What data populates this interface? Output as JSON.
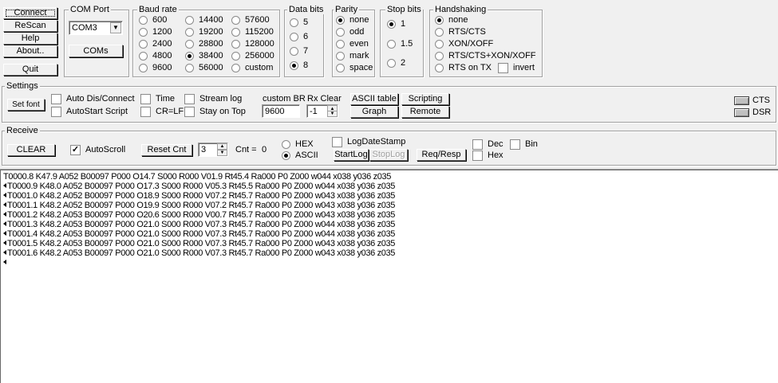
{
  "buttons": {
    "connect": "Connect",
    "rescan": "ReScan",
    "help": "Help",
    "about": "About..",
    "quit": "Quit"
  },
  "com_port": {
    "title": "COM Port",
    "selected": "COM3",
    "coms_button": "COMs"
  },
  "baud_rate": {
    "title": "Baud rate",
    "options": [
      "600",
      "1200",
      "2400",
      "4800",
      "9600",
      "14400",
      "19200",
      "28800",
      "38400",
      "56000",
      "57600",
      "115200",
      "128000",
      "256000",
      "custom"
    ],
    "selected": "38400"
  },
  "data_bits": {
    "title": "Data bits",
    "options": [
      "5",
      "6",
      "7",
      "8"
    ],
    "selected": "8"
  },
  "parity": {
    "title": "Parity",
    "options": [
      "none",
      "odd",
      "even",
      "mark",
      "space"
    ],
    "selected": "none"
  },
  "stop_bits": {
    "title": "Stop bits",
    "options": [
      "1",
      "1.5",
      "2"
    ],
    "selected": "1"
  },
  "handshaking": {
    "title": "Handshaking",
    "options": [
      "none",
      "RTS/CTS",
      "XON/XOFF",
      "RTS/CTS+XON/XOFF",
      "RTS on TX"
    ],
    "selected": "none",
    "invert_label": "invert",
    "invert_checked": false
  },
  "settings": {
    "title": "Settings",
    "set_font": "Set font",
    "auto_dis_connect": "Auto Dis/Connect",
    "autostart_script": "AutoStart Script",
    "time": "Time",
    "cr_lf": "CR=LF",
    "stream_log": "Stream log",
    "stay_on_top": "Stay on Top",
    "custom_br_label": "custom BR",
    "custom_br_value": "9600",
    "rx_clear_label": "Rx Clear",
    "rx_clear_value": "-1",
    "ascii_table": "ASCII table",
    "graph": "Graph",
    "scripting": "Scripting",
    "remote": "Remote"
  },
  "status": {
    "cts": "CTS",
    "dsr": "DSR"
  },
  "receive": {
    "title": "Receive",
    "clear": "CLEAR",
    "autoscroll": "AutoScroll",
    "autoscroll_checked": true,
    "reset_cnt": "Reset Cnt",
    "cnt_spin_value": "3",
    "cnt_label": "Cnt =",
    "cnt_value": "0",
    "hex": "HEX",
    "ascii": "ASCII",
    "mode_selected": "ASCII",
    "log_date_stamp": "LogDateStamp",
    "start_log": "StartLog",
    "stop_log": "StopLog",
    "req_resp": "Req/Resp",
    "dec": "Dec",
    "hex_cb": "Hex",
    "bin": "Bin"
  },
  "terminal": {
    "lines": [
      {
        "arrow": false,
        "text": "T0000.8 K47.9 A052 B00097 P000 O14.7 S000 R000 V01.9 Rt45.4 Ra000 P0 Z000 w044 x038 y036 z035"
      },
      {
        "arrow": true,
        "text": "T0000.9 K48.0 A052 B00097 P000 O17.3 S000 R000 V05.3 Rt45.5 Ra000 P0 Z000 w044 x038 y036 z035"
      },
      {
        "arrow": true,
        "text": "T0001.0 K48.2 A052 B00097 P000 O18.9 S000 R000 V07.2 Rt45.7 Ra000 P0 Z000 w043 x038 y036 z035"
      },
      {
        "arrow": true,
        "text": "T0001.1 K48.2 A052 B00097 P000 O19.9 S000 R000 V07.2 Rt45.7 Ra000 P0 Z000 w043 x038 y036 z035"
      },
      {
        "arrow": true,
        "text": "T0001.2 K48.2 A053 B00097 P000 O20.6 S000 R000 V00.7 Rt45.7 Ra000 P0 Z000 w043 x038 y036 z035"
      },
      {
        "arrow": true,
        "text": "T0001.3 K48.2 A053 B00097 P000 O21.0 S000 R000 V07.3 Rt45.7 Ra000 P0 Z000 w044 x038 y036 z035"
      },
      {
        "arrow": true,
        "text": "T0001.4 K48.2 A053 B00097 P000 O21.0 S000 R000 V07.3 Rt45.7 Ra000 P0 Z000 w044 x038 y036 z035"
      },
      {
        "arrow": true,
        "text": "T0001.5 K48.2 A053 B00097 P000 O21.0 S000 R000 V07.3 Rt45.7 Ra000 P0 Z000 w043 x038 y036 z035"
      },
      {
        "arrow": true,
        "text": "T0001.6 K48.2 A053 B00097 P000 O21.0 S000 R000 V07.3 Rt45.7 Ra000 P0 Z000 w043 x038 y036 z035"
      },
      {
        "arrow": true,
        "text": ""
      }
    ]
  }
}
